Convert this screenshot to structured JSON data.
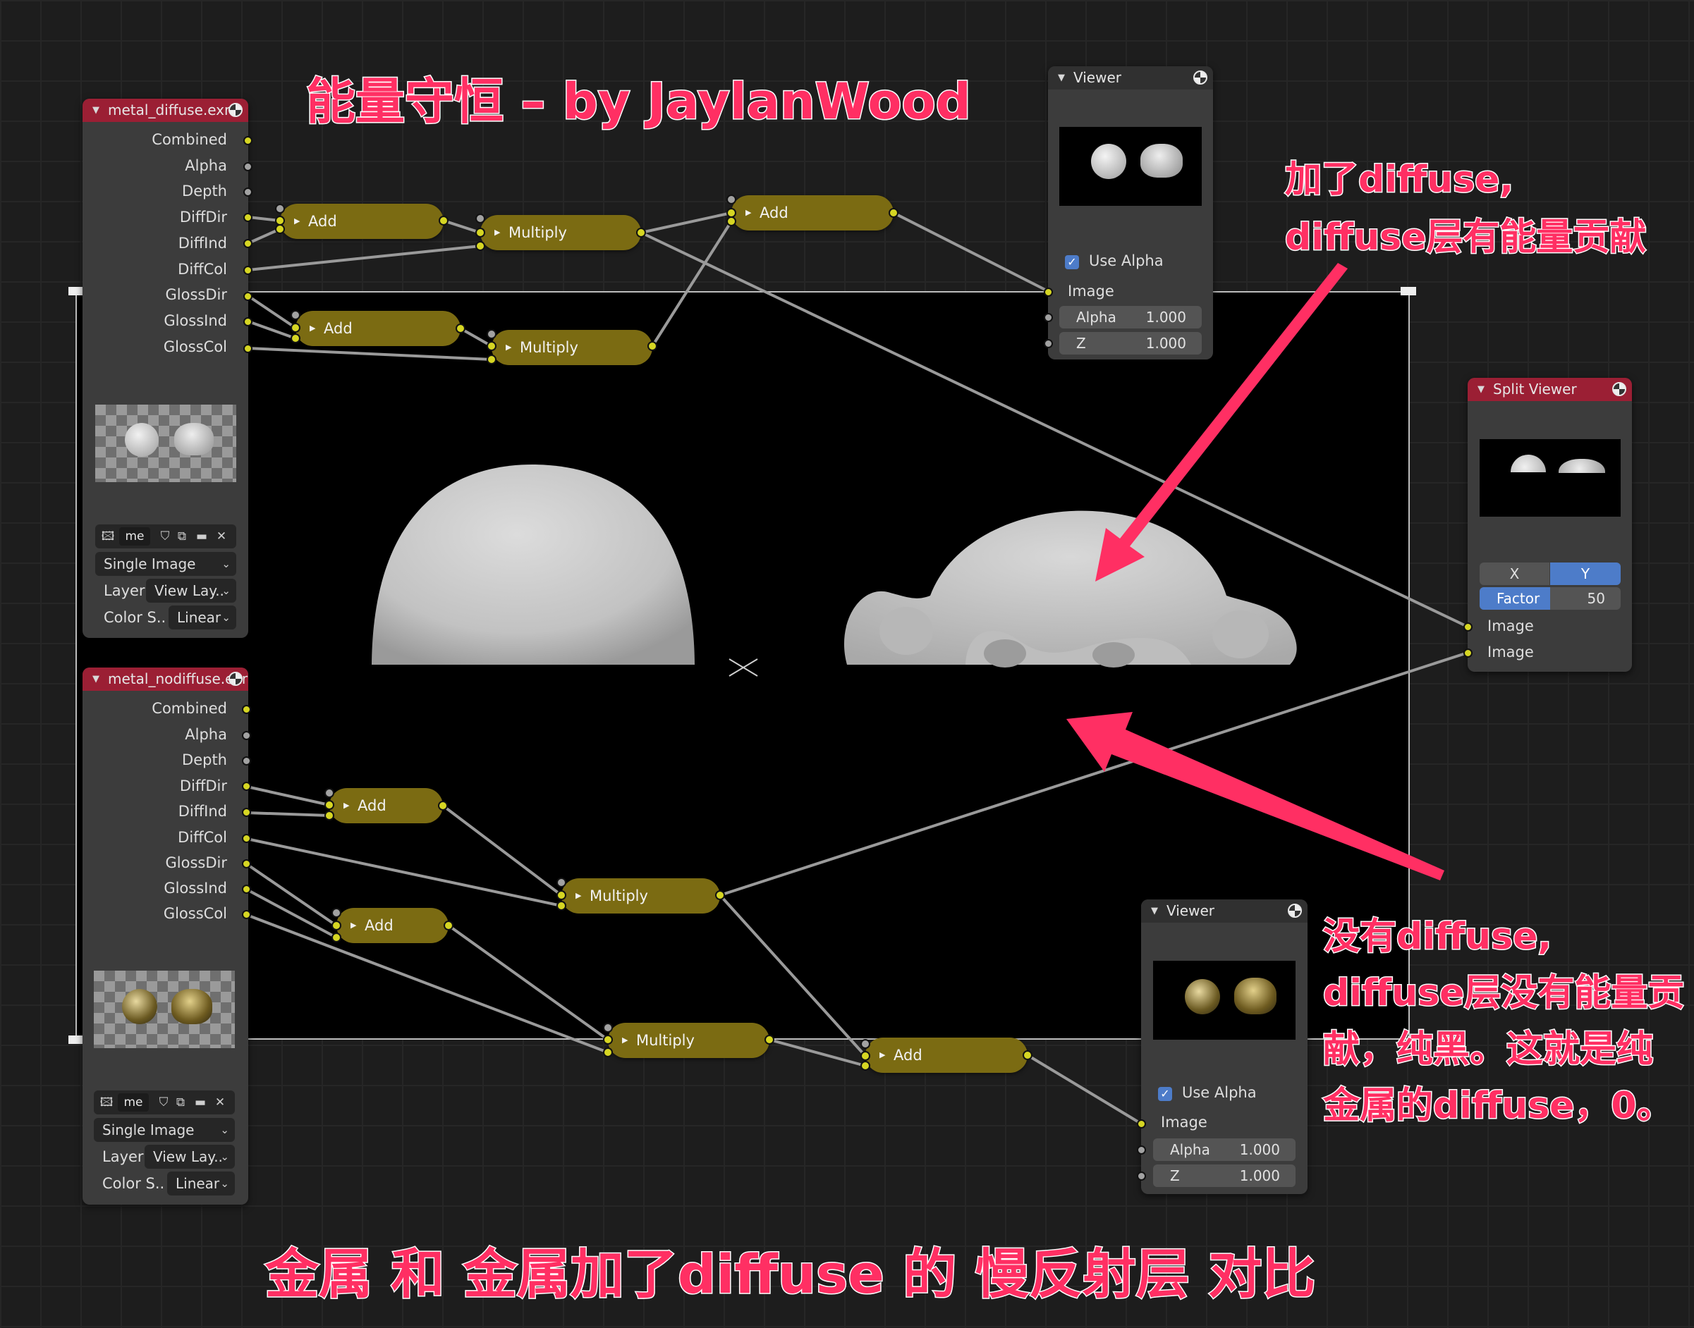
{
  "title_annotation": "能量守恒 – by JaylanWood",
  "bottom_annotation": "金属 和 金属加了diffuse 的 慢反射层 对比",
  "annotation_top_right": [
    "加了diffuse,",
    "diffuse层有能量贡献"
  ],
  "annotation_bottom_right": [
    "没有diffuse,",
    "diffuse层没有能量贡",
    "献，纯黑。这就是纯",
    "金属的diffuse，0。"
  ],
  "image_node_top": {
    "title": "metal_diffuse.exr",
    "outputs": [
      "Combined",
      "Alpha",
      "Depth",
      "DiffDir",
      "DiffInd",
      "DiffCol",
      "GlossDir",
      "GlossInd",
      "GlossCol"
    ],
    "image_name": "me",
    "source": "Single Image",
    "layer_label": "Layer",
    "layer_value": "View Lay..",
    "colorspace_label": "Color S..",
    "colorspace_value": "Linear"
  },
  "image_node_bottom": {
    "title": "metal_nodiffuse.exr",
    "outputs": [
      "Combined",
      "Alpha",
      "Depth",
      "DiffDir",
      "DiffInd",
      "DiffCol",
      "GlossDir",
      "GlossInd",
      "GlossCol"
    ],
    "image_name": "me",
    "source": "Single Image",
    "layer_label": "Layer",
    "layer_value": "View Lay..",
    "colorspace_label": "Color S..",
    "colorspace_value": "Linear"
  },
  "math_nodes": {
    "t_add1": "Add",
    "t_mul1": "Multiply",
    "t_add2": "Add",
    "t_mul2": "Multiply",
    "t_add3": "Add",
    "b_add1": "Add",
    "b_mul1": "Multiply",
    "b_add2": "Add",
    "b_mul2": "Multiply",
    "b_add3": "Add"
  },
  "viewer_top": {
    "title": "Viewer",
    "use_alpha": "Use Alpha",
    "image_input": "Image",
    "alpha_label": "Alpha",
    "alpha_value": "1.000",
    "z_label": "Z",
    "z_value": "1.000"
  },
  "viewer_bottom": {
    "title": "Viewer",
    "use_alpha": "Use Alpha",
    "image_input": "Image",
    "alpha_label": "Alpha",
    "alpha_value": "1.000",
    "z_label": "Z",
    "z_value": "1.000"
  },
  "split_viewer": {
    "title": "Split Viewer",
    "axis_x": "X",
    "axis_y": "Y",
    "axis_selected": "Y",
    "factor_label": "Factor",
    "factor_value": "50",
    "input1": "Image",
    "input2": "Image"
  },
  "colors": {
    "node_header_image": "#9b1f34",
    "math_node": "#7b6b12",
    "socket_yellow": "#d6d623",
    "socket_gray": "#a2a2a2",
    "annotation": "#ff2f63",
    "selection_blue": "#4d7cc9"
  },
  "icons": [
    "image-icon",
    "shield-icon",
    "duplicate-icon",
    "folder-icon",
    "close-icon",
    "render-ball-icon",
    "collapse-arrow-icon",
    "checkbox-icon",
    "chevron-down-icon"
  ]
}
